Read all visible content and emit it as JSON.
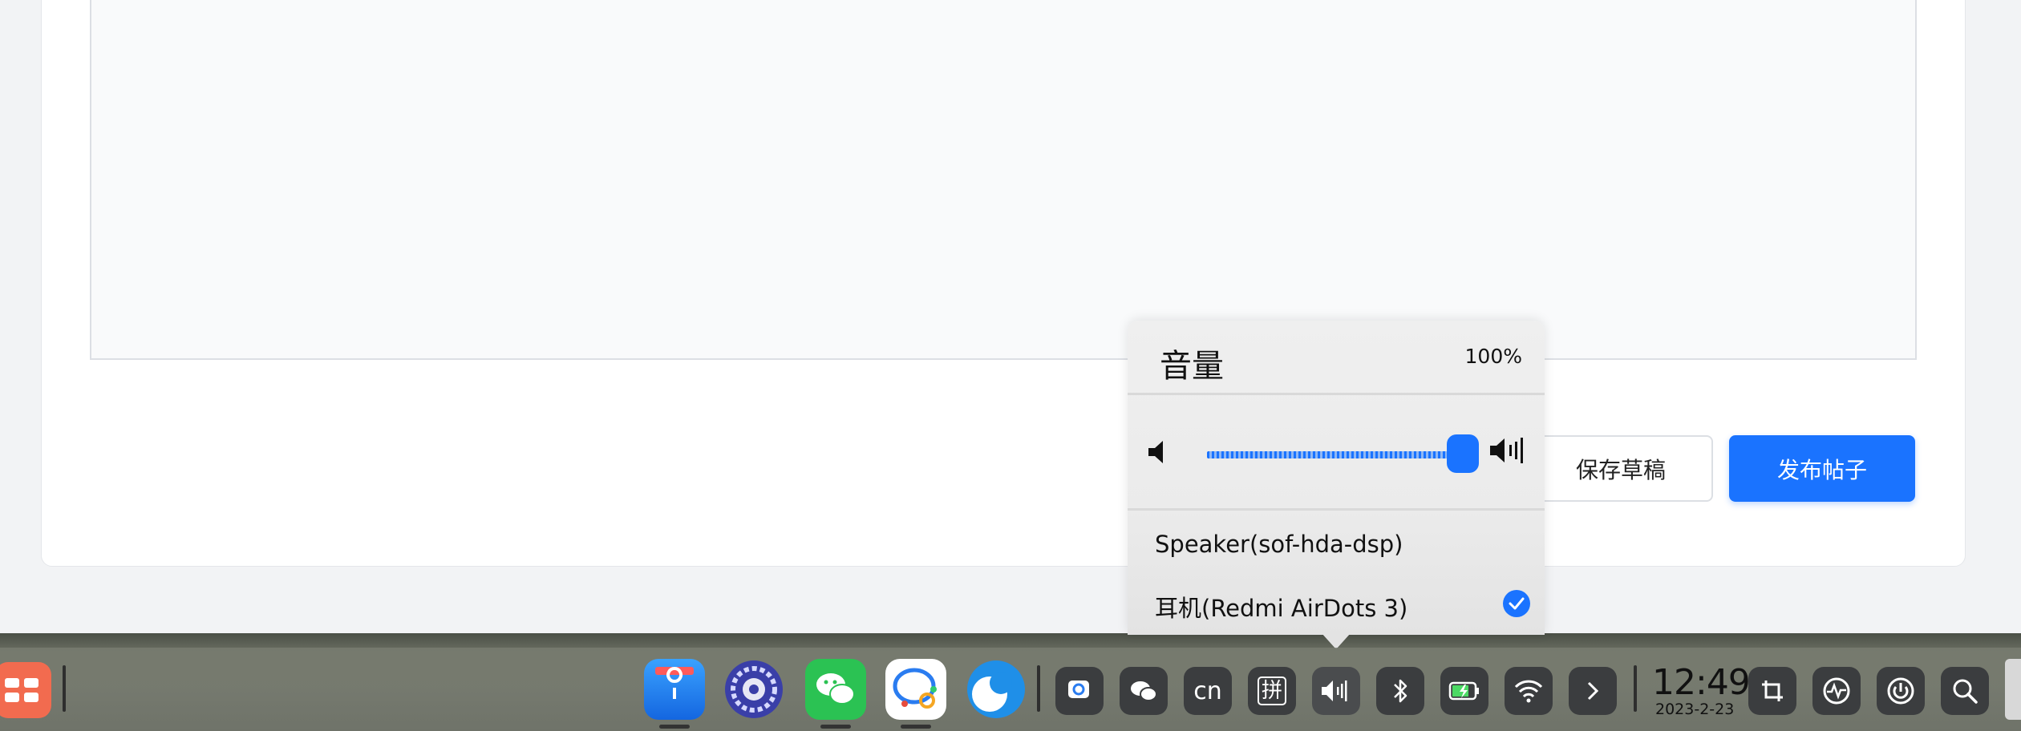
{
  "editor": {
    "save_draft_label": "保存草稿",
    "publish_label": "发布帖子"
  },
  "volume_popup": {
    "title": "音量",
    "percent": "100%",
    "level": 1.0,
    "devices": [
      {
        "label": "Speaker(sof-hda-dsp)",
        "selected": false
      },
      {
        "label": "耳机(Redmi AirDots 3)",
        "selected": true
      }
    ]
  },
  "dock": {
    "apps": [
      {
        "name": "launcher"
      },
      {
        "name": "file-manager"
      },
      {
        "name": "system-settings"
      },
      {
        "name": "wechat"
      },
      {
        "name": "chat-app"
      },
      {
        "name": "browser"
      }
    ],
    "tray": {
      "input_cn": "cn",
      "input_pinyin": "拼"
    },
    "clock": {
      "time": "12:49",
      "date": "2023-2-23"
    }
  },
  "colors": {
    "accent": "#1a73ff",
    "tray_bg": "#3b3d3f"
  }
}
